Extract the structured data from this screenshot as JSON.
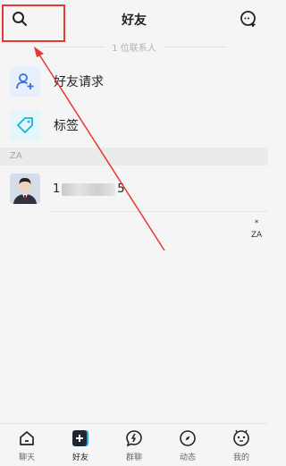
{
  "header": {
    "title": "好友",
    "search_icon": "search-icon",
    "add_icon": "add-contact-icon"
  },
  "contact_count": "1 位联系人",
  "menu": [
    {
      "label": "好友请求",
      "icon": "friend-request-icon"
    },
    {
      "label": "标签",
      "icon": "tag-icon"
    }
  ],
  "section": {
    "letter": "ZA"
  },
  "contact": {
    "name_visible": "1",
    "name_tail": "5"
  },
  "index_bar": [
    "*",
    "ZA"
  ],
  "tabbar": [
    {
      "label": "聊天",
      "icon": "chat-home-icon"
    },
    {
      "label": "好友",
      "icon": "friends-icon",
      "active": true
    },
    {
      "label": "群聊",
      "icon": "group-chat-icon"
    },
    {
      "label": "动态",
      "icon": "moments-icon"
    },
    {
      "label": "我的",
      "icon": "profile-icon"
    }
  ],
  "colors": {
    "annotation": "#e53935",
    "accent": "#1e88e5",
    "request_icon_bg": "#e7eefc",
    "tag_icon_bg": "#e3f7fb"
  }
}
